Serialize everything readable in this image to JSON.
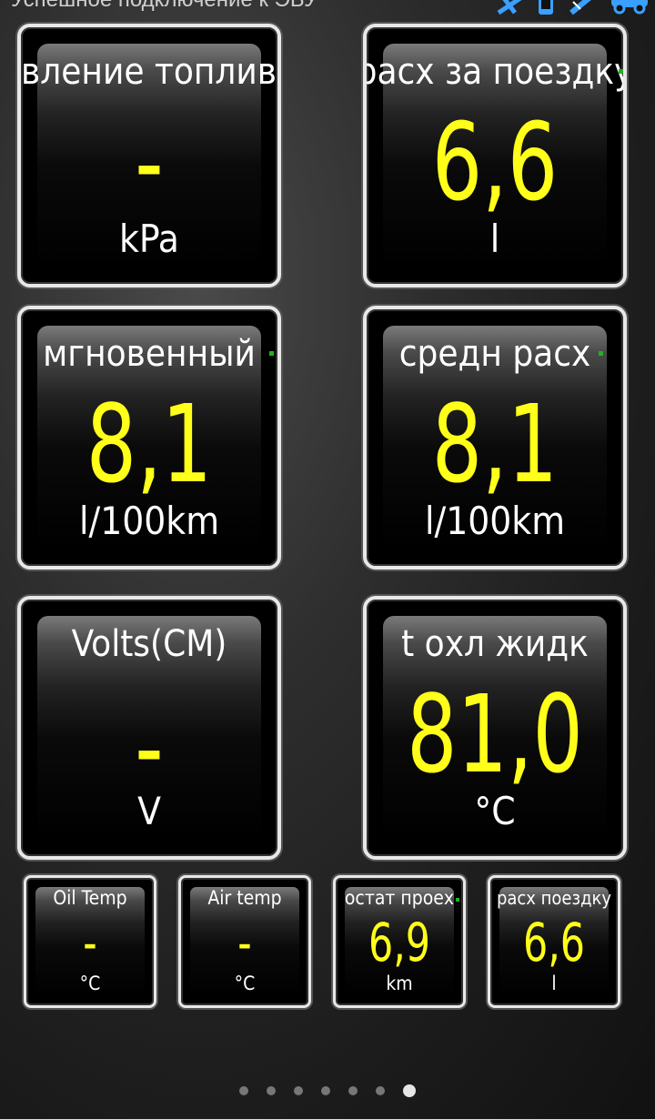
{
  "status": {
    "text": "Успешное подключение к ЭБУ",
    "icons": [
      "gps-icon",
      "phone-icon",
      "satellite-icon",
      "car-icon"
    ]
  },
  "gauges": [
    {
      "title": "авление топлива",
      "value": "-",
      "unit": "kPa"
    },
    {
      "title": "расх за поездку",
      "value": "6,6",
      "unit": "l"
    },
    {
      "title": "мгновенный",
      "value": "8,1",
      "unit": "l/100km"
    },
    {
      "title": "средн расх",
      "value": "8,1",
      "unit": "l/100km"
    },
    {
      "title": "Volts(CM)",
      "value": "-",
      "unit": "V"
    },
    {
      "title": "t охл жидк",
      "value": "81,0",
      "unit": "°C"
    }
  ],
  "small_gauges": [
    {
      "title": "Oil Temp",
      "value": "-",
      "unit": "°C"
    },
    {
      "title": "Air temp",
      "value": "-",
      "unit": "°C"
    },
    {
      "title": "остат проех",
      "value": "6,9",
      "unit": "km"
    },
    {
      "title": "расх поездку",
      "value": "6,6",
      "unit": "l"
    }
  ],
  "pager": {
    "pages": 7,
    "active": 7
  },
  "colors": {
    "value": "#ffff1a",
    "label": "#ffffff",
    "indicator": "#1db41d",
    "border": "#e8e8e8"
  }
}
